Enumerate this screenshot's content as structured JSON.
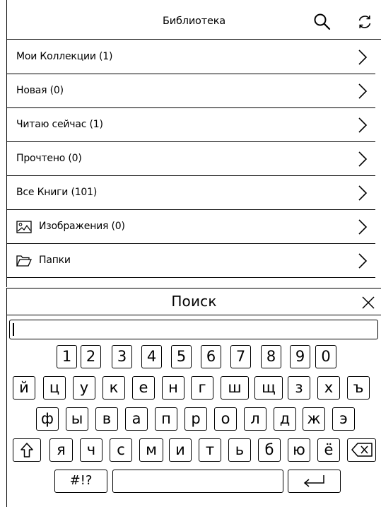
{
  "header": {
    "title": "Библиотека",
    "search_icon": "search-icon",
    "sync_icon": "sync-icon"
  },
  "library": {
    "items": [
      {
        "label": "Мои Коллекции (1)",
        "icon": null
      },
      {
        "label": "Новая (0)",
        "icon": null
      },
      {
        "label": "Читаю сейчас (1)",
        "icon": null
      },
      {
        "label": "Прочтено (0)",
        "icon": null
      },
      {
        "label": "Все Книги (101)",
        "icon": null
      },
      {
        "label": "Изображения (0)",
        "icon": "image-icon"
      },
      {
        "label": "Папки",
        "icon": "folder-icon"
      }
    ]
  },
  "search": {
    "title": "Поиск",
    "value": "",
    "close_icon": "close-icon"
  },
  "keyboard": {
    "digits": [
      "1",
      "2",
      "3",
      "4",
      "5",
      "6",
      "7",
      "8",
      "9",
      "0"
    ],
    "row1": [
      "й",
      "ц",
      "у",
      "к",
      "е",
      "н",
      "г",
      "ш",
      "щ",
      "з",
      "х",
      "ъ"
    ],
    "row2": [
      "ф",
      "ы",
      "в",
      "а",
      "п",
      "р",
      "о",
      "л",
      "д",
      "ж",
      "э"
    ],
    "row3": [
      "я",
      "ч",
      "с",
      "м",
      "и",
      "т",
      "ь",
      "б",
      "ю",
      "ё"
    ],
    "shift_icon": "shift-icon",
    "backspace_icon": "backspace-icon",
    "symbols_label": "#!?",
    "enter_icon": "enter-icon"
  }
}
